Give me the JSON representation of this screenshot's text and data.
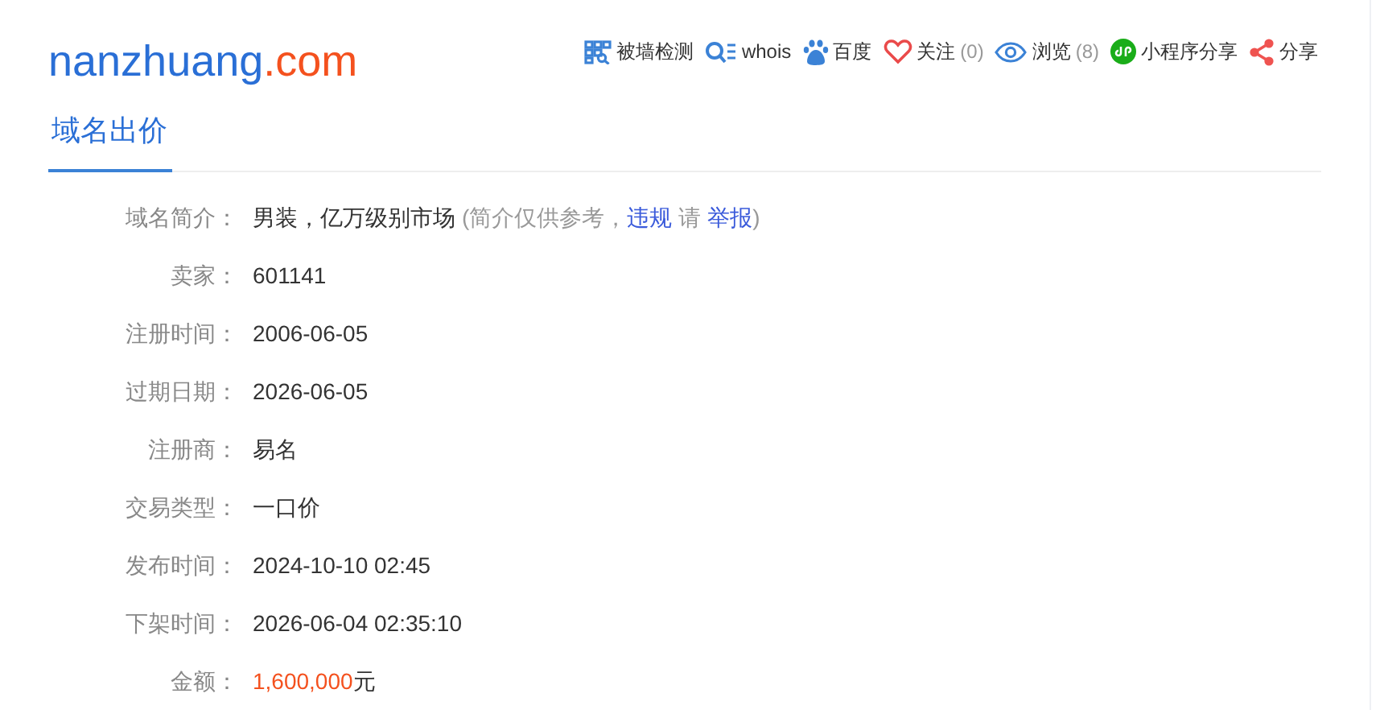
{
  "logo": {
    "name": "nanzhuang",
    "tld": ".com"
  },
  "toolbar": [
    {
      "kind": "blocked",
      "label": "被墙检测"
    },
    {
      "kind": "whois",
      "label": "whois"
    },
    {
      "kind": "paw",
      "label": "百度"
    },
    {
      "kind": "heart",
      "label": "关注",
      "count": "(0)"
    },
    {
      "kind": "eye",
      "label": "浏览",
      "count": "(8)"
    },
    {
      "kind": "mini",
      "label": "小程序分享"
    },
    {
      "kind": "share",
      "label": "分享"
    }
  ],
  "tabs": [
    {
      "label": "域名出价",
      "selected": true
    }
  ],
  "details": [
    {
      "kind": "intro",
      "label": "域名简介：",
      "value": "男装，亿万级别市场",
      "note_open": "(简介仅供参考，",
      "link1": "违规",
      "note_mid": "请",
      "link2": "举报",
      "note_close": ")"
    },
    {
      "kind": "text",
      "label": "卖家：",
      "value": "601141"
    },
    {
      "kind": "text",
      "label": "注册时间：",
      "value": "2006-06-05"
    },
    {
      "kind": "text",
      "label": "过期日期：",
      "value": "2026-06-05"
    },
    {
      "kind": "text",
      "label": "注册商：",
      "value": "易名"
    },
    {
      "kind": "text",
      "label": "交易类型：",
      "value": "一口价"
    },
    {
      "kind": "text",
      "label": "发布时间：",
      "value": "2024-10-10 02:45"
    },
    {
      "kind": "text",
      "label": "下架时间：",
      "value": "2026-06-04 02:35:10"
    },
    {
      "kind": "price",
      "label": "金额：",
      "value": "1,600,000",
      "unit": "元"
    }
  ]
}
